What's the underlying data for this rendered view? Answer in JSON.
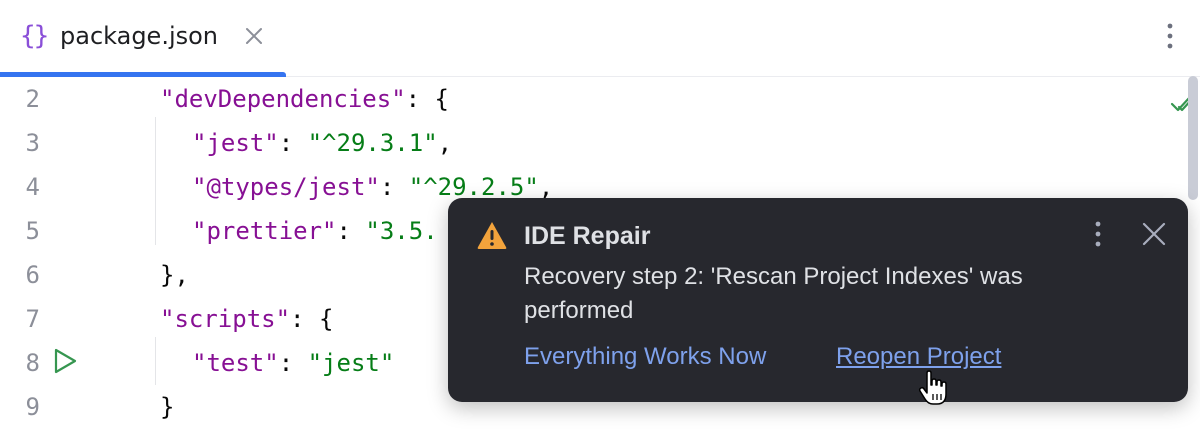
{
  "tab": {
    "icon": "json-braces-icon",
    "icon_glyph": "{}",
    "label": "package.json"
  },
  "editor": {
    "lines": [
      {
        "num": "2"
      },
      {
        "num": "3"
      },
      {
        "num": "4"
      },
      {
        "num": "5"
      },
      {
        "num": "6"
      },
      {
        "num": "7"
      },
      {
        "num": "8"
      },
      {
        "num": "9"
      }
    ],
    "code": {
      "l2_key": "\"devDependencies\"",
      "l2_rest": ": {",
      "l3_key": "\"jest\"",
      "l3_sep": ": ",
      "l3_val": "\"^29.3.1\"",
      "l3_end": ",",
      "l4_key": "\"@types/jest\"",
      "l4_sep": ": ",
      "l4_val": "\"^29.2.5\"",
      "l4_end": ",",
      "l5_key": "\"prettier\"",
      "l5_sep": ": ",
      "l5_val": "\"3.5.",
      "l6": "},",
      "l7_key": "\"scripts\"",
      "l7_rest": ": {",
      "l8_key": "\"test\"",
      "l8_sep": ": ",
      "l8_val": "\"jest\"",
      "l9": "}"
    }
  },
  "notification": {
    "icon": "warning-icon",
    "title": "IDE Repair",
    "body": "Recovery step 2: 'Rescan Project Indexes' was performed",
    "actions": {
      "primary": "Everything Works Now",
      "secondary": "Reopen Project"
    }
  },
  "colors": {
    "accent": "#3574f0",
    "toast_bg": "#27282e",
    "link": "#7ea1ec",
    "string": "#067d17",
    "key": "#871094",
    "warning": "#f2a33c"
  }
}
